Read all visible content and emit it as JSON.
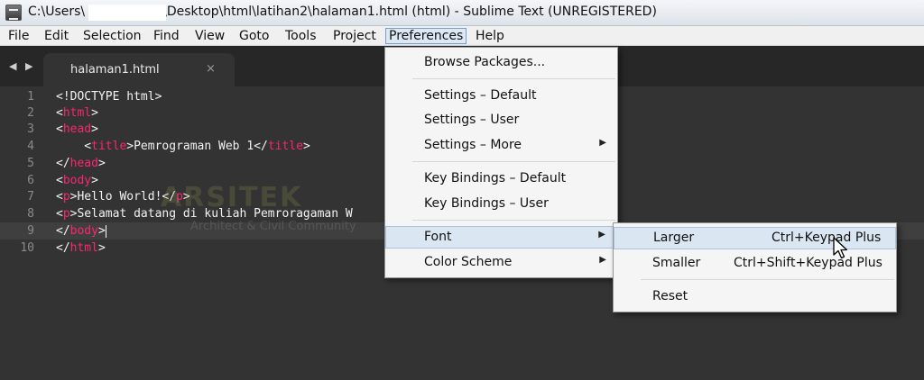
{
  "window": {
    "title_prefix": "C:\\Users\\",
    "title_suffix": "\\Desktop\\html\\latihan2\\halaman1.html (html) - Sublime Text (UNREGISTERED)"
  },
  "menubar": [
    "File",
    "Edit",
    "Selection",
    "Find",
    "View",
    "Goto",
    "Tools",
    "Project",
    "Preferences",
    "Help"
  ],
  "tab": {
    "label": "halaman1.html",
    "close": "×"
  },
  "nav": {
    "back": "◀",
    "forward": "▶"
  },
  "line_numbers": [
    "1",
    "2",
    "3",
    "4",
    "5",
    "6",
    "7",
    "8",
    "9",
    "10"
  ],
  "code": [
    {
      "before": "<!DOCTYPE html>",
      "tag": "",
      "after": ""
    },
    {
      "before": "<",
      "tag": "html",
      "after": ">"
    },
    {
      "before": "<",
      "tag": "head",
      "after": ">"
    },
    {
      "before": "    <",
      "tag": "title",
      "after": ">Pemrograman Web 1</",
      "tag2": "title",
      "after2": ">"
    },
    {
      "before": "</",
      "tag": "head",
      "after": ">"
    },
    {
      "before": "<",
      "tag": "body",
      "after": ">"
    },
    {
      "before": "<",
      "tag": "p",
      "after": ">Hello World!</",
      "tag2": "p",
      "after2": ">"
    },
    {
      "before": "<",
      "tag": "p",
      "after": ">Selamat datang di kuliah Pemroragaman W"
    },
    {
      "before": "</",
      "tag": "body",
      "after": ">"
    },
    {
      "before": "</",
      "tag": "html",
      "after": ">"
    }
  ],
  "watermark": {
    "main": "ARSITEK",
    "sub": "Architect & Civil Community"
  },
  "preferences_menu": {
    "browse_packages": "Browse Packages...",
    "settings_default": "Settings – Default",
    "settings_user": "Settings – User",
    "settings_more": "Settings – More",
    "key_bindings_default": "Key Bindings – Default",
    "key_bindings_user": "Key Bindings – User",
    "font": "Font",
    "color_scheme": "Color Scheme",
    "submenu_arrow": "▶"
  },
  "font_submenu": {
    "larger": "Larger",
    "larger_shortcut": "Ctrl+Keypad Plus",
    "smaller": "Smaller",
    "smaller_shortcut": "Ctrl+Shift+Keypad Plus",
    "reset": "Reset"
  },
  "colors": {
    "editor_bg": "#333333",
    "tag": "#f92672",
    "menu_highlight": "#dbe6f3"
  }
}
